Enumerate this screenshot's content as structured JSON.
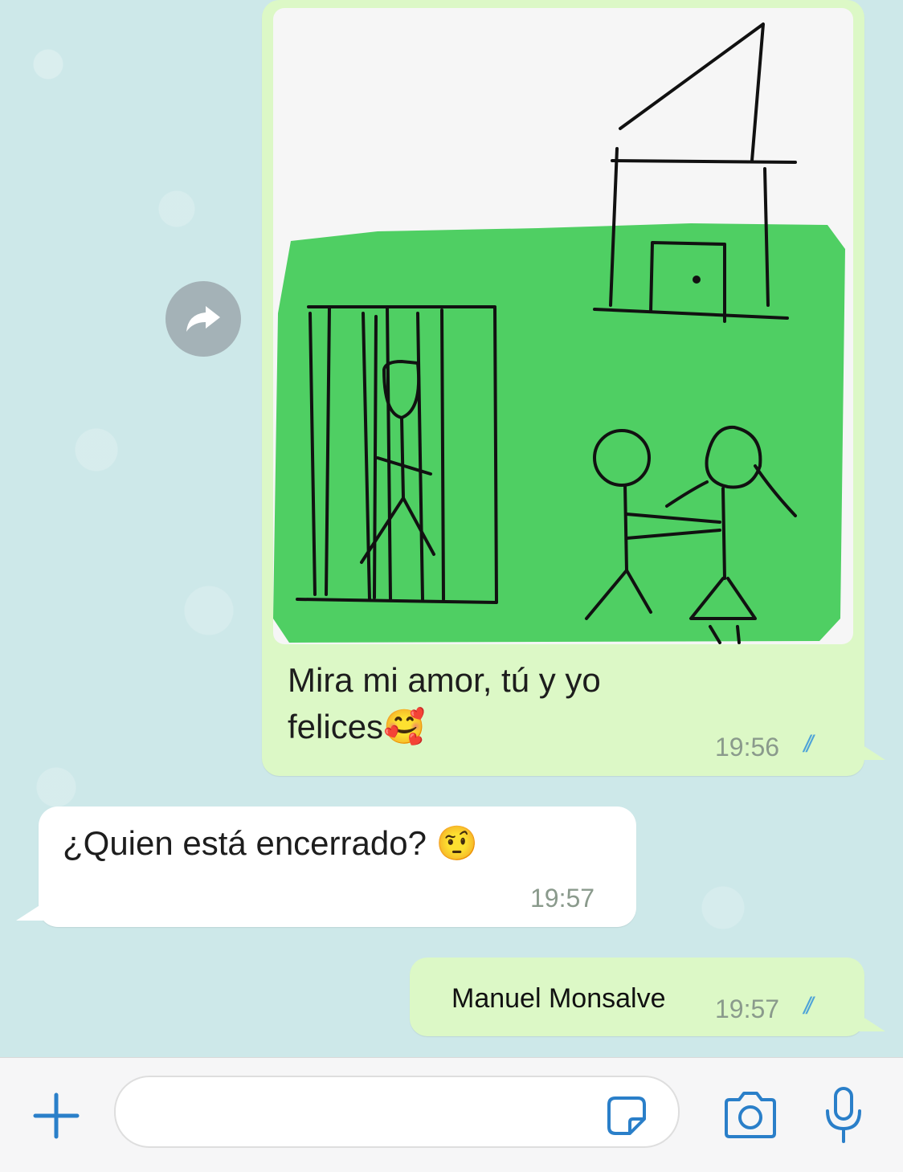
{
  "colors": {
    "outgoing_bubble": "#dcf8c6",
    "incoming_bubble": "#ffffff",
    "read_ticks": "#4fa3d8",
    "icon_blue": "#2a7fc9",
    "drawing_green": "#4fcf63"
  },
  "messages": {
    "image_message": {
      "caption_line1": "Mira mi amor, tú y yo",
      "caption_line2": "felices",
      "caption_emoji": "🥰",
      "time": "19:56",
      "status": "read"
    },
    "incoming": {
      "text": "¿Quien está encerrado?",
      "emoji": "🤨",
      "time": "19:57"
    },
    "outgoing_reply": {
      "text": "Manuel Monsalve",
      "time": "19:57",
      "status": "read"
    }
  },
  "composer": {
    "plus_icon": "plus-icon",
    "sticker_icon": "sticker-icon",
    "camera_icon": "camera-icon",
    "mic_icon": "microphone-icon"
  }
}
